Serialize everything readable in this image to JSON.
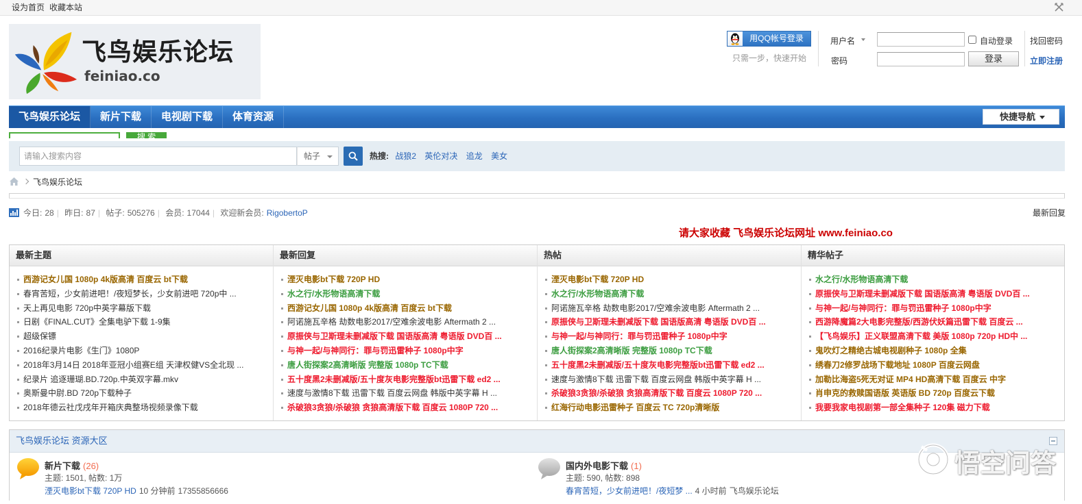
{
  "topbar": {
    "set_home": "设为首页",
    "bookmark": "收藏本站"
  },
  "logo": {
    "title": "飞鸟娱乐论坛",
    "domain": "feiniao.co"
  },
  "login": {
    "qq_button": "用QQ帐号登录",
    "qq_hint": "只需一步，快速开始",
    "username_label": "用户名",
    "username_value": "",
    "password_label": "密码",
    "password_value": "",
    "auto_login": "自动登录",
    "forgot_password": "找回密码",
    "login_button": "登录",
    "register": "立即注册"
  },
  "nav": {
    "items": [
      {
        "label": "飞鸟娱乐论坛",
        "active": true
      },
      {
        "label": "新片下载",
        "active": false
      },
      {
        "label": "电视剧下载",
        "active": false
      },
      {
        "label": "体育资源",
        "active": false
      }
    ],
    "quick_nav": "快捷导航"
  },
  "legacy_search": {
    "button": "搜 索"
  },
  "search": {
    "placeholder": "请输入搜索内容",
    "value": "",
    "scope": "帖子",
    "hot_label": "热搜:",
    "hot": [
      "战狼2",
      "英伦对决",
      "追龙",
      "美女"
    ]
  },
  "breadcrumb": {
    "current": "飞鸟娱乐论坛"
  },
  "stats": {
    "items": [
      {
        "label": "今日:",
        "value": "28"
      },
      {
        "label": "昨日:",
        "value": "87"
      },
      {
        "label": "帖子:",
        "value": "505276"
      },
      {
        "label": "会员:",
        "value": "17044"
      }
    ],
    "separator": "|",
    "new_member_label": "欢迎新会员:",
    "new_member": "RigobertoP",
    "latest_reply": "最新回复"
  },
  "notice": "请大家收藏 飞鸟娱乐论坛网址 www.feiniao.co",
  "colors": {
    "olive": "#996600",
    "green": "#3C9D40",
    "red": "#EE1B2E",
    "notice": "#CC0000",
    "nav": "#2A6FC0",
    "link": "#2B65B7"
  },
  "columns": [
    {
      "title": "最新主题",
      "items": [
        {
          "text": "西游记女儿国 1080p 4k版高清 百度云 bt下载",
          "hl": "olive"
        },
        {
          "text": "春宵苦短，少女前进吧！/夜短梦长，少女前进吧 720p中 ...",
          "hl": null
        },
        {
          "text": "天上再见电影 720p中英字幕版下载",
          "hl": null
        },
        {
          "text": "日剧《FINAL.CUT》全集电驴下载 1-9集",
          "hl": null
        },
        {
          "text": "超级保镖",
          "hl": null
        },
        {
          "text": "2016纪录片电影《生门》1080P",
          "hl": null
        },
        {
          "text": "2018年3月14日 2018年亚冠小组赛E组 天津权健VS全北现 ...",
          "hl": null
        },
        {
          "text": "纪录片 追逐珊瑚.BD.720p.中英双字幕.mkv",
          "hl": null
        },
        {
          "text": "奥斯曼中尉.BD 720p下载种子",
          "hl": null
        },
        {
          "text": "2018年德云社戊戌年开箱庆典整场视频录像下载",
          "hl": null
        }
      ]
    },
    {
      "title": "最新回复",
      "items": [
        {
          "text": "湮灭电影bt下载 720P HD",
          "hl": "olive"
        },
        {
          "text": "水之行/水形物语高清下载",
          "hl": "green"
        },
        {
          "text": "西游记女儿国 1080p 4k版高清 百度云 bt下载",
          "hl": "olive"
        },
        {
          "text": "阿诺施瓦辛格 劫数电影2017/空难余波电影 Aftermath 2 ...",
          "hl": null
        },
        {
          "text": "原振侠与卫斯理未删减版下载 国语版高清 粤语版 DVD百 ...",
          "hl": "red"
        },
        {
          "text": "与神一起/与神同行：罪与罚迅雷种子 1080p中字",
          "hl": "red"
        },
        {
          "text": "唐人街探案2高清晰版 完整版 1080p TC下载",
          "hl": "green"
        },
        {
          "text": "五十度黑2未删减版/五十度灰电影完整版bt迅雷下载 ed2 ...",
          "hl": "red"
        },
        {
          "text": "速度与激情8下载 迅雷下载 百度云网盘 韩版中英字幕 H ...",
          "hl": null
        },
        {
          "text": "杀破狼3贪狼/杀破狼 贪狼高清版下载 百度云 1080P 720 ...",
          "hl": "red"
        }
      ]
    },
    {
      "title": "热帖",
      "items": [
        {
          "text": "湮灭电影bt下载 720P HD",
          "hl": "olive"
        },
        {
          "text": "水之行/水形物语高清下载",
          "hl": "green"
        },
        {
          "text": "阿诺施瓦辛格 劫数电影2017/空难余波电影 Aftermath 2 ...",
          "hl": null
        },
        {
          "text": "原振侠与卫斯理未删减版下载 国语版高清 粤语版 DVD百 ...",
          "hl": "red"
        },
        {
          "text": "与神一起/与神同行：罪与罚迅雷种子 1080p中字",
          "hl": "red"
        },
        {
          "text": "唐人街探案2高清晰版 完整版 1080p TC下载",
          "hl": "green"
        },
        {
          "text": "五十度黑2未删减版/五十度灰电影完整版bt迅雷下载 ed2 ...",
          "hl": "red"
        },
        {
          "text": "速度与激情8下载 迅雷下载 百度云网盘 韩版中英字幕 H ...",
          "hl": null
        },
        {
          "text": "杀破狼3贪狼/杀破狼 贪狼高清版下载 百度云 1080P 720 ...",
          "hl": "red"
        },
        {
          "text": "红海行动电影迅雷种子 百度云 TC 720p清晰版",
          "hl": "olive"
        }
      ]
    },
    {
      "title": "精华帖子",
      "items": [
        {
          "text": "水之行/水形物语高清下载",
          "hl": "green"
        },
        {
          "text": "原振侠与卫斯理未删减版下载 国语版高清 粤语版 DVD百 ...",
          "hl": "red"
        },
        {
          "text": "与神一起/与神同行：罪与罚迅雷种子 1080p中字",
          "hl": "red"
        },
        {
          "text": "西游降魔篇2大电影完整版/西游伏妖篇迅雷下载 百度云 ...",
          "hl": "red"
        },
        {
          "text": "【飞鸟娱乐】正义联盟高清下载 美版 1080p 720p HD中 ...",
          "hl": "red"
        },
        {
          "text": "鬼吹灯之精绝古城电视剧种子 1080p 全集",
          "hl": "olive"
        },
        {
          "text": "绣春刀2修罗战场下载地址 1080P 百度云网盘",
          "hl": "olive"
        },
        {
          "text": "加勒比海盗5死无对证 MP4 HD高清下载 百度云 中字",
          "hl": "olive"
        },
        {
          "text": "肖申克的救赎国语版 英语版 BD 720p 百度云下载",
          "hl": "olive"
        },
        {
          "text": "我要我家电视剧第一部全集种子 120集 磁力下载",
          "hl": "red"
        }
      ]
    }
  ],
  "forum_section": {
    "title": "飞鸟娱乐论坛 资源大区",
    "forums": [
      {
        "name": "新片下载",
        "today": "(26)",
        "stats": "主题: 1501, 帖数: 1万",
        "last_post": "湮灭电影bt下载 720P HD",
        "last_time": "10 分钟前",
        "last_author": "17355856666",
        "has_new": true
      },
      {
        "name": "国内外电影下载",
        "today": "(1)",
        "stats": "主题: 590, 帖数: 898",
        "last_post": "春宵苦短，少女前进吧！/夜短梦 ...",
        "last_time": "4 小时前",
        "last_author": "飞鸟娱乐论坛",
        "has_new": false
      }
    ]
  },
  "watermark": {
    "text": "悟空问答"
  },
  "icons": {
    "close": "close-icon",
    "logo": "bird-leaf-logo-icon",
    "qq": "qq-penguin-icon",
    "dropdown": "chevron-down-icon",
    "search": "search-icon",
    "home": "home-icon",
    "breadcrumb_separator": "chevron-right-icon",
    "stats": "bar-chart-icon",
    "collapse": "collapse-icon",
    "forum_new": "forum-new-bubble-icon",
    "forum_old": "forum-bubble-icon",
    "watermark_logo": "wukong-logo-icon"
  }
}
